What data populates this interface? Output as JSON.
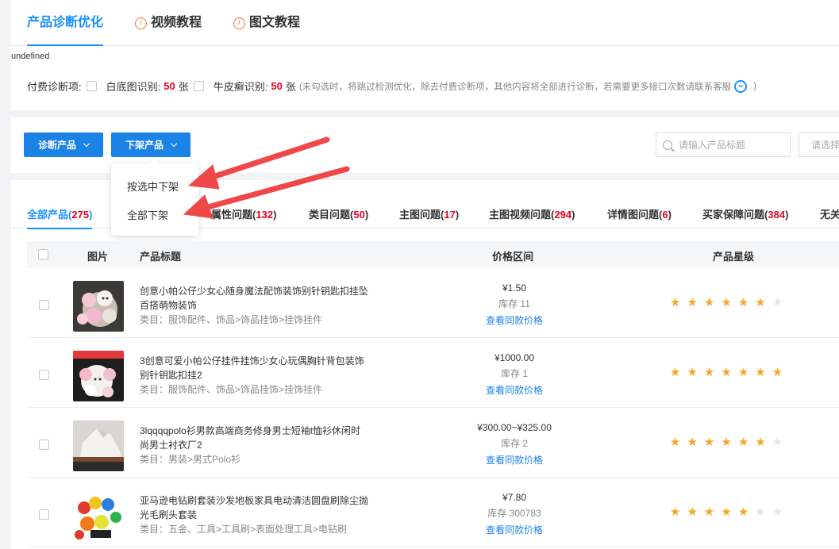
{
  "tabs_top": [
    {
      "label": "产品诊断优化",
      "active": true
    },
    {
      "label": "视频教程",
      "icon": "info-icon"
    },
    {
      "label": "图文教程",
      "icon": "info-icon"
    }
  ],
  "undefined_text": "undefined",
  "paid_row": {
    "label": "付费诊断项:",
    "white_bg_label": "白底图识别:",
    "white_bg_count": "50",
    "white_bg_unit": "张",
    "psoriasis_label": "牛皮癣识别:",
    "psoriasis_count": "50",
    "psoriasis_unit": "张",
    "note_open": "(未勾选时，将跳过检测优化，除去付费诊断项，其他内容将全部进行诊断，若需要更多接口次数请联系客服",
    "note_close": ")"
  },
  "actions": {
    "diagnose_label": "诊断产品",
    "delist_label": "下架产品",
    "search_placeholder": "请输入产品标题",
    "select_placeholder": "请选择"
  },
  "dropdown": {
    "items": [
      "按选中下架",
      "全部下架"
    ]
  },
  "product_tabs": [
    {
      "name": "全部产品",
      "count": "275",
      "active": true
    },
    {
      "name": "属性问题",
      "count": "132"
    },
    {
      "name": "类目问题",
      "count": "50"
    },
    {
      "name": "主图问题",
      "count": "17"
    },
    {
      "name": "主图视频问题",
      "count": "294"
    },
    {
      "name": "详情图问题",
      "count": "6"
    },
    {
      "name": "买家保障问题",
      "count": "384"
    },
    {
      "name": "无关"
    }
  ],
  "table": {
    "headers": {
      "image": "图片",
      "title": "产品标题",
      "price": "价格区间",
      "stars": "产品星级"
    },
    "rows": [
      {
        "title": "创意小帕公仔少女心随身魔法配饰装饰别针钥匙扣挂坠百搭萌物装饰",
        "category": "类目：服饰配件、饰品>饰品挂饰>挂饰挂件",
        "price": "¥1.50",
        "stock": "库存 11",
        "link": "查看同款价格",
        "rating": 6
      },
      {
        "title": "3创意可爱小帕公仔挂件挂饰少女心玩偶胸针背包装饰别针钥匙扣挂2",
        "category": "类目：服饰配件、饰品>饰品挂饰>挂饰挂件",
        "price": "¥1000.00",
        "stock": "库存 1",
        "link": "查看同款价格",
        "rating": 7
      },
      {
        "title": "3lqqqqpolo衫男款高端商务修身男士短袖t恤衫休闲时尚男士衬衣厂2",
        "category": "类目：男装>男式Polo衫",
        "price": "¥300.00~¥325.00",
        "stock": "库存 2",
        "link": "查看同款价格",
        "rating": 6
      },
      {
        "title": "亚马逊电钻刷套装沙发地板家具电动清洁圆盘刷除尘抛光毛刷头套装",
        "category": "类目：五金、工具>工具刷>表面处理工具>电钻刷",
        "price": "¥7.80",
        "stock": "库存 300783",
        "link": "查看同款价格",
        "rating": 5
      }
    ]
  },
  "colors": {
    "accent": "#1b82e6",
    "count_red": "#e8001c",
    "star": "#f5a623",
    "annotation_arrow": "#f04848"
  }
}
